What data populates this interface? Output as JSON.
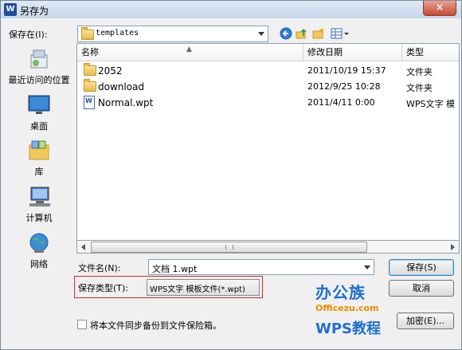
{
  "window": {
    "title": "另存为",
    "app_icon": "W",
    "close_glyph": "×"
  },
  "location": {
    "label": "保存在(I):",
    "value": "templates"
  },
  "toolbar": {
    "icons": [
      "back-icon",
      "up-folder-icon",
      "new-folder-icon",
      "view-menu-icon"
    ]
  },
  "places": [
    {
      "label": "最近访问的位置",
      "icon": "recent-places-icon"
    },
    {
      "label": "桌面",
      "icon": "desktop-icon"
    },
    {
      "label": "库",
      "icon": "libraries-icon"
    },
    {
      "label": "计算机",
      "icon": "computer-icon"
    },
    {
      "label": "网络",
      "icon": "network-icon"
    }
  ],
  "file_list": {
    "columns": [
      "名称",
      "修改日期",
      "类型"
    ],
    "rows": [
      {
        "name": "2052",
        "date": "2011/10/19 15:37",
        "type": "文件夹",
        "icon": "folder-icon"
      },
      {
        "name": "download",
        "date": "2012/9/25 10:28",
        "type": "文件夹",
        "icon": "folder-icon"
      },
      {
        "name": "Normal.wpt",
        "date": "2011/4/11 0:00",
        "type": "WPS文字 模",
        "icon": "wps-document-icon"
      }
    ]
  },
  "filename": {
    "label": "文件名(N):",
    "value": "文档 1.wpt"
  },
  "filetype": {
    "label": "保存类型(T):",
    "value": "WPS文字 模板文件(*.wpt)"
  },
  "buttons": {
    "save": "保存(S)",
    "cancel": "取消",
    "encrypt": "加密(E)..."
  },
  "backup_checkbox": {
    "label": "将本文件同步备份到文件保险箱。",
    "checked": false
  },
  "watermark": {
    "line1": "办公族",
    "line2": "Officezu.com",
    "line3": "WPS教程"
  },
  "colors": {
    "accent": "#1f4e9a",
    "highlight_box": "#d9262c",
    "watermark_blue": "#1e6fd0",
    "watermark_orange": "#f08a00"
  }
}
